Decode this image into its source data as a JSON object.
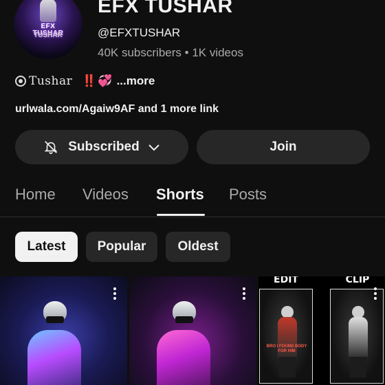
{
  "channel": {
    "name": "EFX TUSHAR",
    "handle": "@EFXTUSHAR",
    "subscribers": "40K subscribers",
    "separator": "•",
    "videos": "1K videos",
    "avatar_text_line1": "EFX TUSHAR",
    "avatar_text_line2": "TUSHAR"
  },
  "description": {
    "name": "Tushar",
    "middle": "‼️",
    "heart": "💞",
    "more": "...more"
  },
  "link": {
    "url": "urlwala.com/Agaiw9AF",
    "more": " and 1 more link"
  },
  "buttons": {
    "subscribed": "Subscribed",
    "join": "Join"
  },
  "tabs": [
    {
      "label": "Home"
    },
    {
      "label": "Videos"
    },
    {
      "label": "Shorts"
    },
    {
      "label": "Posts"
    }
  ],
  "active_tab": "Shorts",
  "chips": [
    {
      "label": "Latest",
      "selected": true
    },
    {
      "label": "Popular",
      "selected": false
    },
    {
      "label": "Oldest",
      "selected": false
    }
  ],
  "shorts": [
    {
      "id": "short-1"
    },
    {
      "id": "short-2"
    },
    {
      "id": "short-3",
      "left_label": "EDIT",
      "right_label": "CLIP",
      "caption": "BRO I FOUND BODY FOR HIM"
    }
  ],
  "colors": {
    "background": "#0f0f0f",
    "surface": "#272727",
    "text": "#f1f1f1",
    "muted": "#aaaaaa"
  }
}
